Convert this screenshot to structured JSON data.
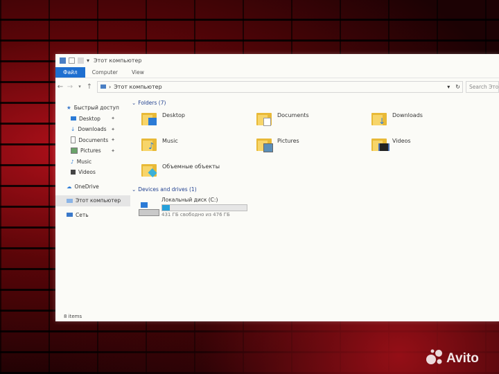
{
  "window": {
    "title": "Этот компьютер",
    "ribbon_tabs": [
      "Файл",
      "Computer",
      "View"
    ],
    "address": "Этот компьютер",
    "search_placeholder": "Search Этот компьютер"
  },
  "nav": {
    "items": [
      {
        "label": "Быстрый доступ",
        "icon": "star-icon"
      },
      {
        "label": "Desktop",
        "icon": "desktop-icon",
        "pinned": true
      },
      {
        "label": "Downloads",
        "icon": "download-icon",
        "pinned": true
      },
      {
        "label": "Documents",
        "icon": "document-icon",
        "pinned": true
      },
      {
        "label": "Pictures",
        "icon": "picture-icon",
        "pinned": true
      },
      {
        "label": "Music",
        "icon": "music-icon"
      },
      {
        "label": "Videos",
        "icon": "video-icon"
      },
      {
        "label": "OneDrive",
        "icon": "cloud-icon"
      },
      {
        "label": "Этот компьютер",
        "icon": "computer-icon",
        "selected": true
      },
      {
        "label": "Сеть",
        "icon": "network-icon"
      }
    ]
  },
  "folders": {
    "header": "Folders (7)",
    "items": [
      {
        "label": "Desktop",
        "icon": "desktop-folder-icon"
      },
      {
        "label": "Documents",
        "icon": "documents-folder-icon"
      },
      {
        "label": "Downloads",
        "icon": "downloads-folder-icon"
      },
      {
        "label": "Music",
        "icon": "music-folder-icon"
      },
      {
        "label": "Pictures",
        "icon": "pictures-folder-icon"
      },
      {
        "label": "Videos",
        "icon": "videos-folder-icon"
      },
      {
        "label": "Объемные объекты",
        "icon": "3d-objects-folder-icon"
      }
    ]
  },
  "drives": {
    "header": "Devices and drives (1)",
    "items": [
      {
        "label": "Локальный диск (C:)",
        "free_text": "431 ГБ свободно из 476 ГБ",
        "used_fraction": 0.094
      }
    ]
  },
  "status": "8 items",
  "colors": {
    "accent": "#1e6fd0",
    "folder": "#e8b937",
    "group_header": "#1f3f8f"
  },
  "watermark": "Avito"
}
